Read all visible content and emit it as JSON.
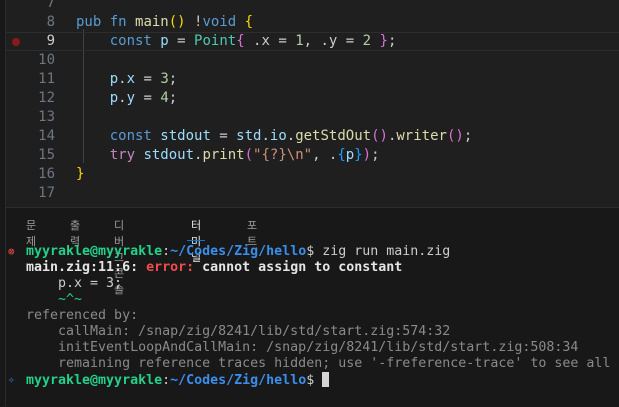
{
  "editor": {
    "lines": [
      {
        "n": "7",
        "tokens": []
      },
      {
        "n": "8",
        "tokens": [
          [
            "pub ",
            "kw"
          ],
          [
            "fn ",
            "kw"
          ],
          [
            "main",
            "fn"
          ],
          [
            "(",
            "b1"
          ],
          [
            ")",
            "b1"
          ],
          [
            " !",
            "pl"
          ],
          [
            "void",
            "kw"
          ],
          [
            " ",
            "pl"
          ],
          [
            "{",
            "b1"
          ]
        ]
      },
      {
        "n": "9",
        "tokens": [
          [
            "    ",
            "pl"
          ],
          [
            "const ",
            "kw"
          ],
          [
            "p",
            "var"
          ],
          [
            " = ",
            "pl"
          ],
          [
            "Point",
            "ty"
          ],
          [
            "{",
            "b2"
          ],
          [
            " .x = ",
            "pl"
          ],
          [
            "1",
            "num"
          ],
          [
            ", .y = ",
            "pl"
          ],
          [
            "2",
            "num"
          ],
          [
            " ",
            "pl"
          ],
          [
            "}",
            "b2"
          ],
          [
            ";",
            "pl"
          ]
        ]
      },
      {
        "n": "10",
        "tokens": []
      },
      {
        "n": "11",
        "tokens": [
          [
            "    ",
            "pl"
          ],
          [
            "p",
            "var"
          ],
          [
            ".",
            "pl"
          ],
          [
            "x",
            "var"
          ],
          [
            " = ",
            "pl"
          ],
          [
            "3",
            "num"
          ],
          [
            ";",
            "pl"
          ]
        ]
      },
      {
        "n": "12",
        "tokens": [
          [
            "    ",
            "pl"
          ],
          [
            "p",
            "var"
          ],
          [
            ".",
            "pl"
          ],
          [
            "y",
            "var"
          ],
          [
            " = ",
            "pl"
          ],
          [
            "4",
            "num"
          ],
          [
            ";",
            "pl"
          ]
        ]
      },
      {
        "n": "13",
        "tokens": []
      },
      {
        "n": "14",
        "tokens": [
          [
            "    ",
            "pl"
          ],
          [
            "const ",
            "kw"
          ],
          [
            "stdout",
            "var"
          ],
          [
            " = ",
            "pl"
          ],
          [
            "std",
            "var"
          ],
          [
            ".",
            "pl"
          ],
          [
            "io",
            "var"
          ],
          [
            ".",
            "pl"
          ],
          [
            "getStdOut",
            "fn"
          ],
          [
            "(",
            "b2"
          ],
          [
            ")",
            "b2"
          ],
          [
            ".",
            "pl"
          ],
          [
            "writer",
            "fn"
          ],
          [
            "(",
            "b2"
          ],
          [
            ")",
            "b2"
          ],
          [
            ";",
            "pl"
          ]
        ]
      },
      {
        "n": "15",
        "tokens": [
          [
            "    ",
            "pl"
          ],
          [
            "try ",
            "kw2"
          ],
          [
            "stdout",
            "var"
          ],
          [
            ".",
            "pl"
          ],
          [
            "print",
            "fn"
          ],
          [
            "(",
            "b2"
          ],
          [
            "\"{?}\\n\"",
            "str"
          ],
          [
            ", .",
            "pl"
          ],
          [
            "{",
            "b3"
          ],
          [
            "p",
            "var"
          ],
          [
            "}",
            "b3"
          ],
          [
            ")",
            "b2"
          ],
          [
            ";",
            "pl"
          ]
        ]
      },
      {
        "n": "16",
        "tokens": [
          [
            "}",
            "b1"
          ]
        ]
      },
      {
        "n": "17",
        "tokens": []
      }
    ],
    "active_line": "9",
    "breakpoint_line": "9"
  },
  "panel": {
    "tabs": [
      {
        "label": "문제",
        "active": false
      },
      {
        "label": "출력",
        "active": false
      },
      {
        "label": "디버그 콘솔",
        "active": false
      },
      {
        "label": "터미널",
        "active": true
      },
      {
        "label": "포트",
        "active": false
      }
    ]
  },
  "terminal": {
    "lines": [
      {
        "deco": "⊗",
        "deco_color": "#f14c4c",
        "tokens": [
          [
            "myyrakle@myyrakle",
            "green"
          ],
          [
            ":",
            "pl"
          ],
          [
            "~/Codes/Zig/hello",
            "blue"
          ],
          [
            "$ zig run main.zig",
            "pl"
          ]
        ]
      },
      {
        "tokens": [
          [
            "main.zig:11:6: ",
            "bold"
          ],
          [
            "error: ",
            "red"
          ],
          [
            "cannot assign to constant",
            "bold"
          ]
        ]
      },
      {
        "tokens": [
          [
            "    p.x = 3;",
            "pl"
          ]
        ]
      },
      {
        "tokens": [
          [
            "    ~^~",
            "tilde"
          ]
        ]
      },
      {
        "tokens": [
          [
            "referenced by:",
            "dim"
          ]
        ]
      },
      {
        "tokens": [
          [
            "    callMain: /snap/zig/8241/lib/std/start.zig:574:32",
            "dim"
          ]
        ]
      },
      {
        "tokens": [
          [
            "    initEventLoopAndCallMain: /snap/zig/8241/lib/std/start.zig:508:34",
            "dim"
          ]
        ]
      },
      {
        "tokens": [
          [
            "    remaining reference traces hidden; use '-freference-trace' to see all",
            "dim"
          ]
        ]
      },
      {
        "deco": "✧",
        "deco_color": "#3b8eea",
        "tokens": [
          [
            "myyrakle@myyrakle",
            "green"
          ],
          [
            ":",
            "pl"
          ],
          [
            "~/Codes/Zig/hello",
            "blue"
          ],
          [
            "$ ",
            "pl"
          ]
        ],
        "cursor": true
      }
    ]
  }
}
